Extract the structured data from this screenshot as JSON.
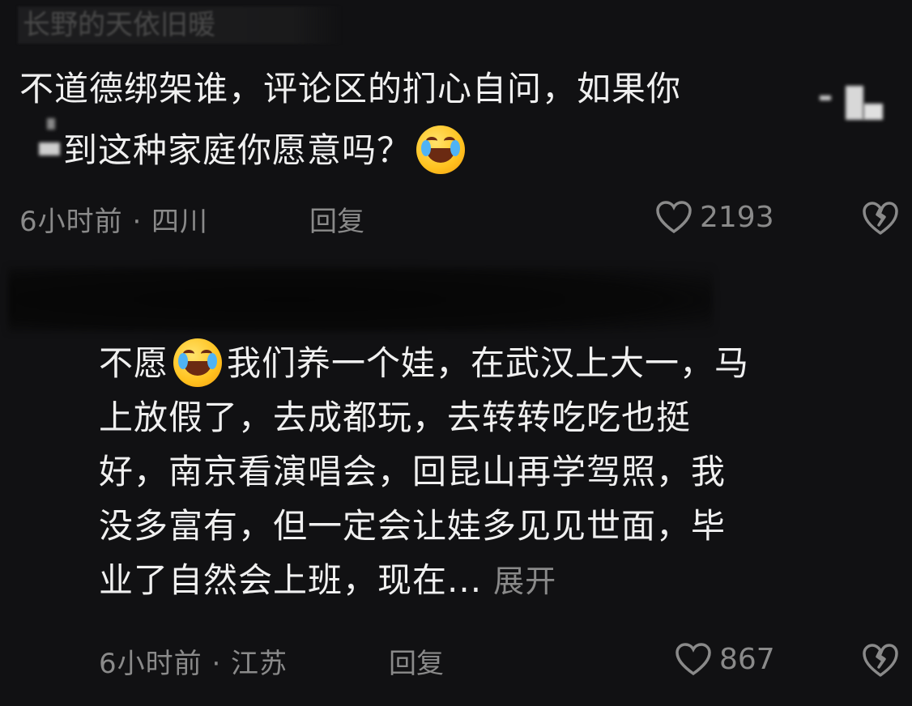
{
  "comment1": {
    "username": "长野的天依旧暖",
    "line1": "不道德绑架谁，评论区的扪心自问，如果你",
    "line2": "到这种家庭你愿意吗？",
    "emoji": "face-with-tears-of-joy",
    "time_location": "6小时前 · 四川",
    "reply_label": "回复",
    "likes": "2193"
  },
  "comment2": {
    "text_before_emoji": "不愿",
    "emoji": "face-with-tears-of-joy",
    "line1_after": "我们养一个娃，在武汉上大一，马",
    "line2": "上放假了，去成都玩，去转转吃吃也挺",
    "line3": "好，南京看演唱会，回昆山再学驾照，我",
    "line4": "没多富有，但一定会让娃多见见世面，毕",
    "line5": "业了自然会上班，现在...",
    "expand_label": "展开",
    "time_location": "6小时前 · 江苏",
    "reply_label": "回复",
    "likes": "867"
  },
  "colors": {
    "background": "#111113",
    "text": "#f0f0f0",
    "meta": "#8a8a8a"
  }
}
